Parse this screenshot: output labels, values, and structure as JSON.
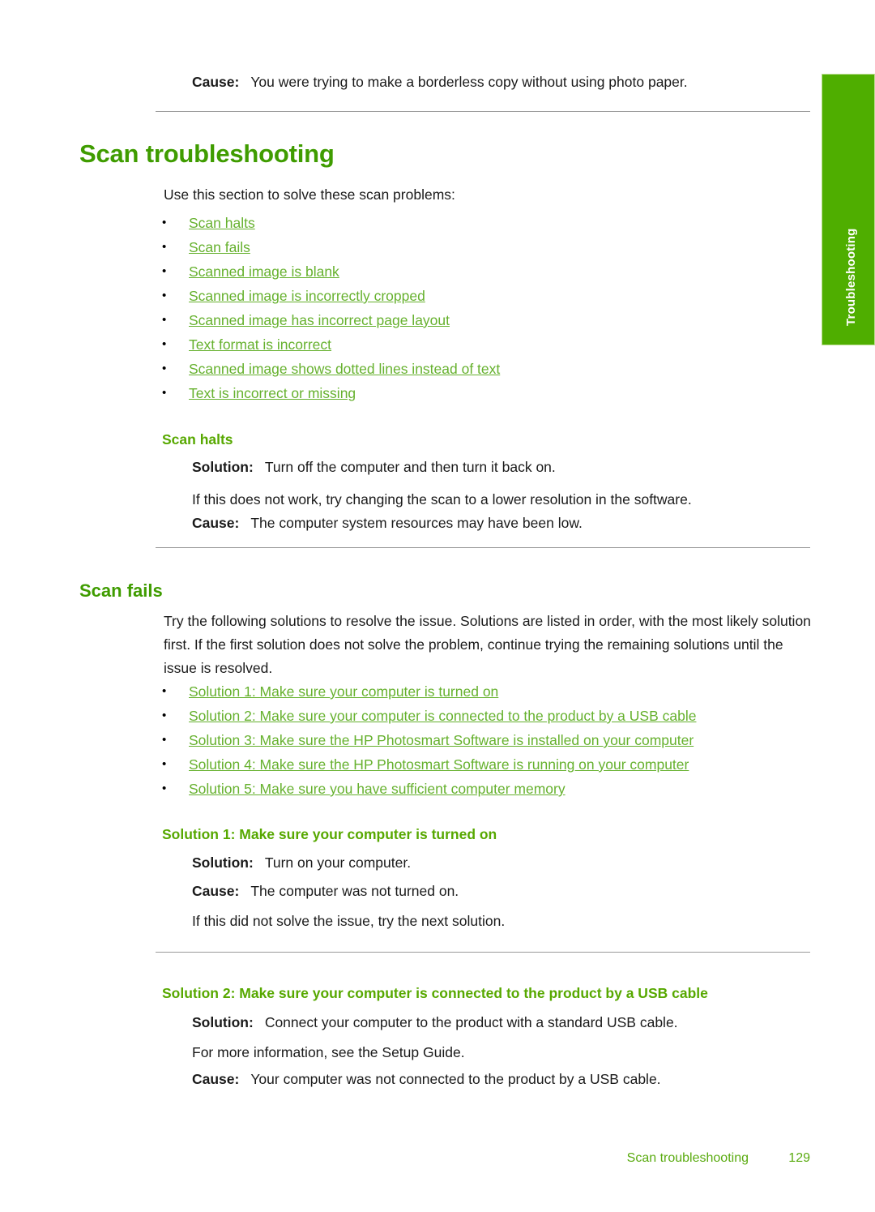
{
  "side_tab": {
    "label": "Troubleshooting"
  },
  "top_cause": {
    "label": "Cause:",
    "text": "You were trying to make a borderless copy without using photo paper."
  },
  "title": "Scan troubleshooting",
  "intro": "Use this section to solve these scan problems:",
  "problem_links": [
    "Scan halts",
    "Scan fails",
    "Scanned image is blank",
    "Scanned image is incorrectly cropped",
    "Scanned image has incorrect page layout",
    "Text format is incorrect",
    "Scanned image shows dotted lines instead of text",
    "Text is incorrect or missing"
  ],
  "scan_halts": {
    "heading": "Scan halts",
    "solution_label": "Solution:",
    "solution_text": "Turn off the computer and then turn it back on.",
    "note": "If this does not work, try changing the scan to a lower resolution in the software.",
    "cause_label": "Cause:",
    "cause_text": "The computer system resources may have been low."
  },
  "scan_fails": {
    "heading": "Scan fails",
    "paragraph": "Try the following solutions to resolve the issue. Solutions are listed in order, with the most likely solution first. If the first solution does not solve the problem, continue trying the remaining solutions until the issue is resolved.",
    "solution_links": [
      "Solution 1: Make sure your computer is turned on",
      "Solution 2: Make sure your computer is connected to the product by a USB cable",
      "Solution 3: Make sure the HP Photosmart Software is installed on your computer",
      "Solution 4: Make sure the HP Photosmart Software is running on your computer",
      "Solution 5: Make sure you have sufficient computer memory"
    ]
  },
  "solution_1": {
    "heading": "Solution 1: Make sure your computer is turned on",
    "solution_label": "Solution:",
    "solution_text": "Turn on your computer.",
    "cause_label": "Cause:",
    "cause_text": "The computer was not turned on.",
    "note": "If this did not solve the issue, try the next solution."
  },
  "solution_2": {
    "heading": "Solution 2: Make sure your computer is connected to the product by a USB cable",
    "solution_label": "Solution:",
    "solution_text": "Connect your computer to the product with a standard USB cable.",
    "note": "For more information, see the Setup Guide.",
    "cause_label": "Cause:",
    "cause_text": "Your computer was not connected to the product by a USB cable."
  },
  "footer": {
    "text": "Scan troubleshooting",
    "page": "129"
  },
  "colors": {
    "heading_green": "#3f9c00",
    "link_green": "#66b12e",
    "tab_green": "#4fae00",
    "rule_gray": "#9a9a9a"
  }
}
